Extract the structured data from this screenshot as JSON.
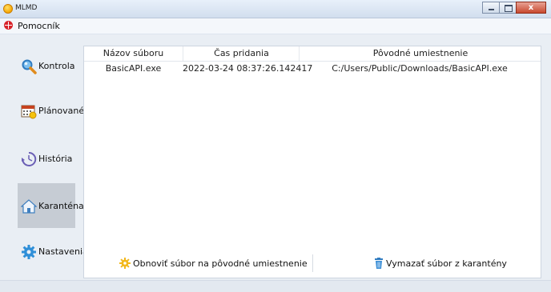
{
  "window": {
    "title": "MLMD",
    "close_glyph": "x"
  },
  "menu": {
    "help_label": "Pomocník"
  },
  "sidebar": {
    "items": [
      {
        "label": "Kontrola",
        "icon": "magnifier-icon"
      },
      {
        "label": "Plánované",
        "icon": "calendar-icon"
      },
      {
        "label": "História",
        "icon": "history-icon"
      },
      {
        "label": "Karanténa",
        "icon": "house-icon",
        "active": true
      },
      {
        "label": "Nastavenia",
        "icon": "gear-icon"
      }
    ]
  },
  "table": {
    "columns": [
      "Názov súboru",
      "Čas pridania",
      "Pôvodné umiestnenie"
    ],
    "rows": [
      [
        "BasicAPI.exe",
        "2022-03-24 08:37:26.142417",
        "C:/Users/Public/Downloads/BasicAPI.exe"
      ]
    ]
  },
  "actions": {
    "restore_label": "Obnoviť súbor na pôvodné umiestnenie",
    "delete_label": "Vymazať súbor z karantény"
  },
  "colors": {
    "active_nav": "#c6ccd4",
    "window_bg": "#e9eef4",
    "close_button": "#c8492f"
  }
}
